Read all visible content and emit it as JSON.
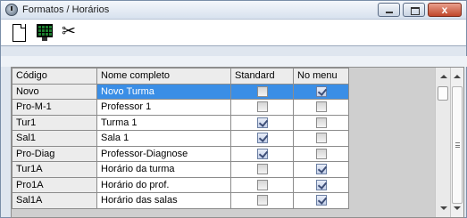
{
  "window": {
    "title": "Formatos / Horários",
    "close_label": "x"
  },
  "toolbar": {
    "scissors_glyph": "✂"
  },
  "grid": {
    "columns": [
      "Código",
      "Nome completo",
      "Standard",
      "No menu"
    ],
    "rows": [
      {
        "code": "Novo",
        "name": "Novo Turma",
        "standard": false,
        "no_menu": true,
        "selected": true
      },
      {
        "code": "Pro-M-1",
        "name": "Professor 1",
        "standard": false,
        "no_menu": false,
        "selected": false
      },
      {
        "code": "Tur1",
        "name": "Turma 1",
        "standard": true,
        "no_menu": false,
        "selected": false
      },
      {
        "code": "Sal1",
        "name": "Sala 1",
        "standard": true,
        "no_menu": false,
        "selected": false
      },
      {
        "code": "Pro-Diag",
        "name": "Professor-Diagnose",
        "standard": true,
        "no_menu": false,
        "selected": false
      },
      {
        "code": "Tur1A",
        "name": "Horário da turma",
        "standard": false,
        "no_menu": true,
        "selected": false
      },
      {
        "code": "Pro1A",
        "name": "Horário do prof.",
        "standard": false,
        "no_menu": true,
        "selected": false
      },
      {
        "code": "Sal1A",
        "name": "Horário das salas",
        "standard": false,
        "no_menu": true,
        "selected": false
      }
    ]
  },
  "colors": {
    "selection": "#3a8ee6",
    "grid_background": "#cfcfcf",
    "title_close": "#c0472b"
  }
}
